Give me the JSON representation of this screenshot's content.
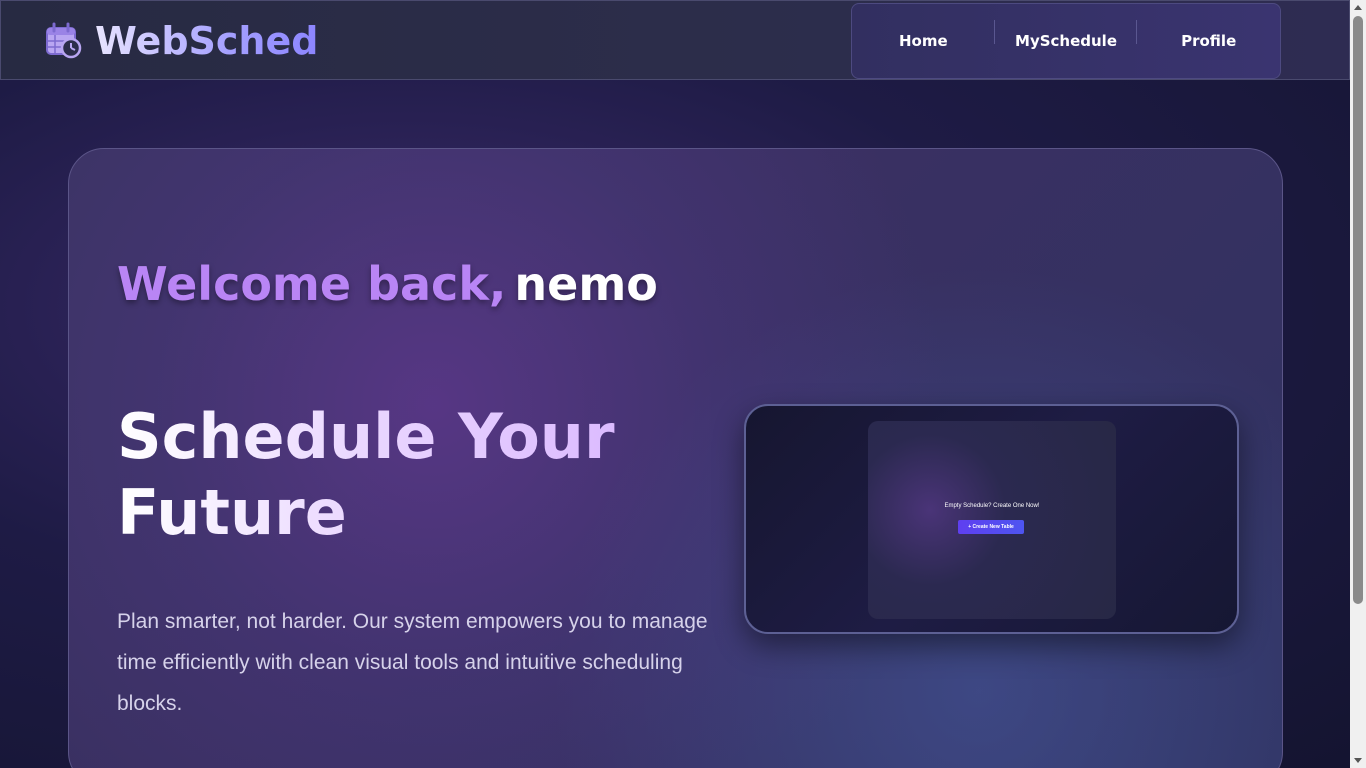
{
  "app": {
    "name": "WebSched",
    "logo_icon": "calendar-clock-icon"
  },
  "nav": {
    "items": [
      "Home",
      "MySchedule",
      "Profile"
    ]
  },
  "hero": {
    "greeting": "Welcome back,",
    "username": "nemo",
    "headline": "Schedule Your Future",
    "description": "Plan smarter, not harder. Our system empowers you to manage time efficiently with clean visual tools and intuitive scheduling blocks."
  },
  "preview": {
    "empty_text": "Empty Schedule? Create One Now!",
    "create_button": "+ Create New Table"
  },
  "colors": {
    "accent_purple": "#b985f5",
    "logo_gradient_end": "#8c85ff",
    "button_blue": "#4e55f0"
  }
}
